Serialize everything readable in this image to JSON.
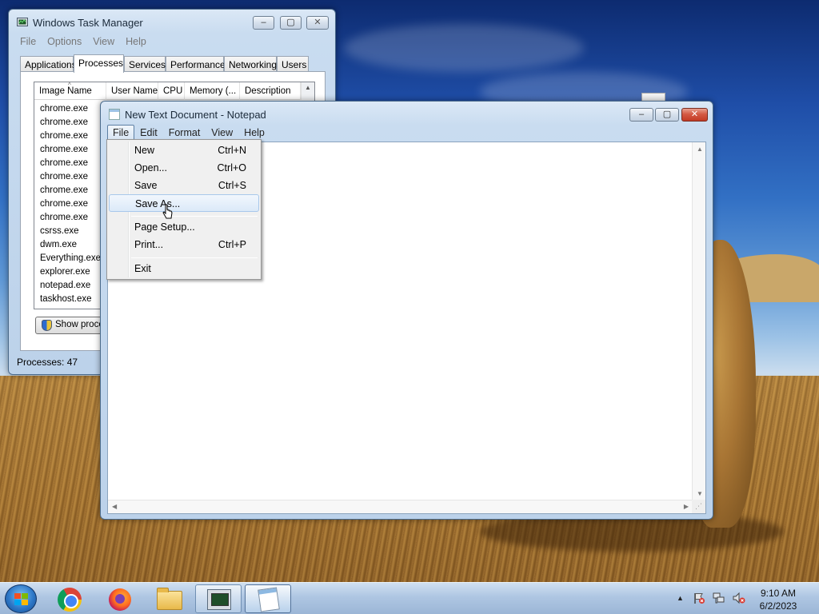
{
  "task_manager": {
    "title": "Windows Task Manager",
    "menu": [
      "File",
      "Options",
      "View",
      "Help"
    ],
    "tabs": [
      "Applications",
      "Processes",
      "Services",
      "Performance",
      "Networking",
      "Users"
    ],
    "active_tab": "Processes",
    "columns": [
      "Image Name",
      "User Name",
      "CPU",
      "Memory (...",
      "Description"
    ],
    "processes": [
      "chrome.exe",
      "chrome.exe",
      "chrome.exe",
      "chrome.exe",
      "chrome.exe",
      "chrome.exe",
      "chrome.exe",
      "chrome.exe",
      "chrome.exe",
      "csrss.exe",
      "dwm.exe",
      "Everything.exe",
      "explorer.exe",
      "notepad.exe",
      "taskhost.exe"
    ],
    "show_button": "Show processes from all users",
    "status": "Processes: 47"
  },
  "notepad": {
    "title": "New Text Document - Notepad",
    "menu": [
      "File",
      "Edit",
      "Format",
      "View",
      "Help"
    ],
    "open_menu": "File",
    "content": ""
  },
  "file_menu": {
    "items": [
      {
        "label": "New",
        "shortcut": "Ctrl+N"
      },
      {
        "label": "Open...",
        "shortcut": "Ctrl+O"
      },
      {
        "label": "Save",
        "shortcut": "Ctrl+S"
      },
      {
        "label": "Save As...",
        "shortcut": "",
        "hovered": true
      },
      {
        "label": "Page Setup...",
        "shortcut": ""
      },
      {
        "label": "Print...",
        "shortcut": "Ctrl+P"
      },
      {
        "label": "Exit",
        "shortcut": ""
      }
    ]
  },
  "window_controls": {
    "minimize": "–",
    "maximize": "▢",
    "close": "✕"
  },
  "taskbar": {
    "start_icon": "windows-logo-icon",
    "pinned": [
      "chrome-icon",
      "firefox-icon",
      "file-explorer-icon",
      "task-manager-icon",
      "notepad-icon"
    ],
    "tray_expand": "▲",
    "time": "9:10 AM",
    "date": "6/2/2023"
  }
}
